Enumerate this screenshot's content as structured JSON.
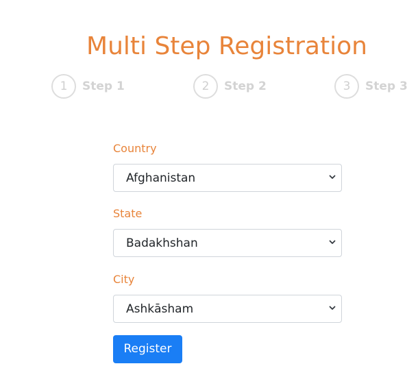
{
  "header": {
    "title": "Multi Step Registration"
  },
  "steps": [
    {
      "number": "1",
      "label": "Step 1"
    },
    {
      "number": "2",
      "label": "Step 2"
    },
    {
      "number": "3",
      "label": "Step 3"
    }
  ],
  "form": {
    "country": {
      "label": "Country",
      "value": "Afghanistan"
    },
    "state": {
      "label": "State",
      "value": "Badakhshan"
    },
    "city": {
      "label": "City",
      "value": "Ashkāsham"
    },
    "register_label": "Register"
  },
  "colors": {
    "accent": "#e8843a",
    "primary_button": "#1a7ef5",
    "step_inactive": "#d3d3d3"
  }
}
